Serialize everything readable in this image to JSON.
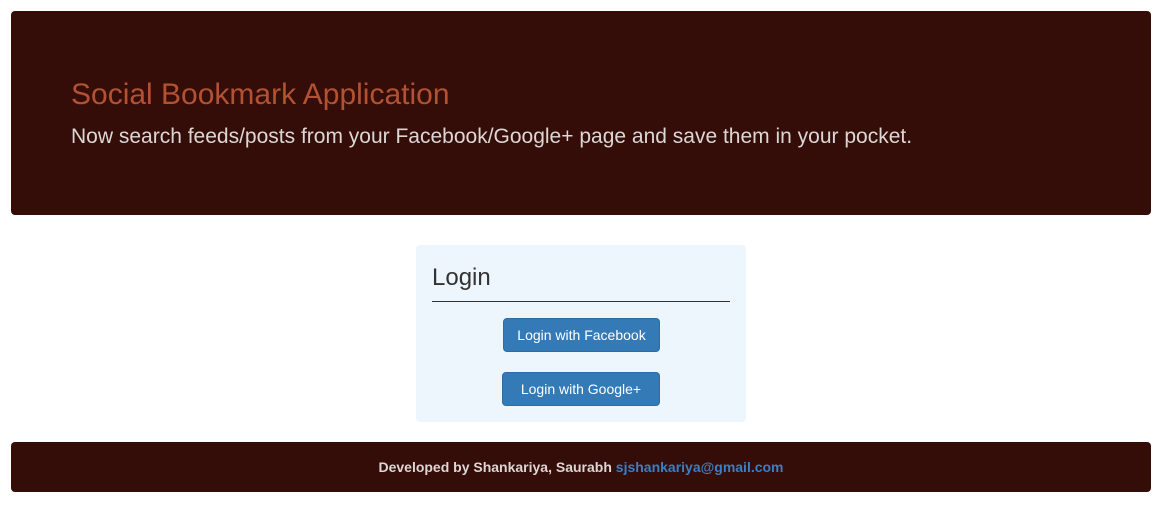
{
  "header": {
    "title": "Social Bookmark Application",
    "subtitle": "Now search feeds/posts from your Facebook/Google+ page and save them in your pocket."
  },
  "login": {
    "heading": "Login",
    "facebook_button": "Login with Facebook",
    "google_button": "Login with Google+"
  },
  "footer": {
    "developed_by": "Developed by Shankariya, Saurabh",
    "email": "sjshankariya@gmail.com"
  },
  "colors": {
    "banner_background": "#340d09",
    "title": "#b25232",
    "button": "#337ab7",
    "panel_background": "#eef6fd",
    "link": "#3a7fc4"
  }
}
